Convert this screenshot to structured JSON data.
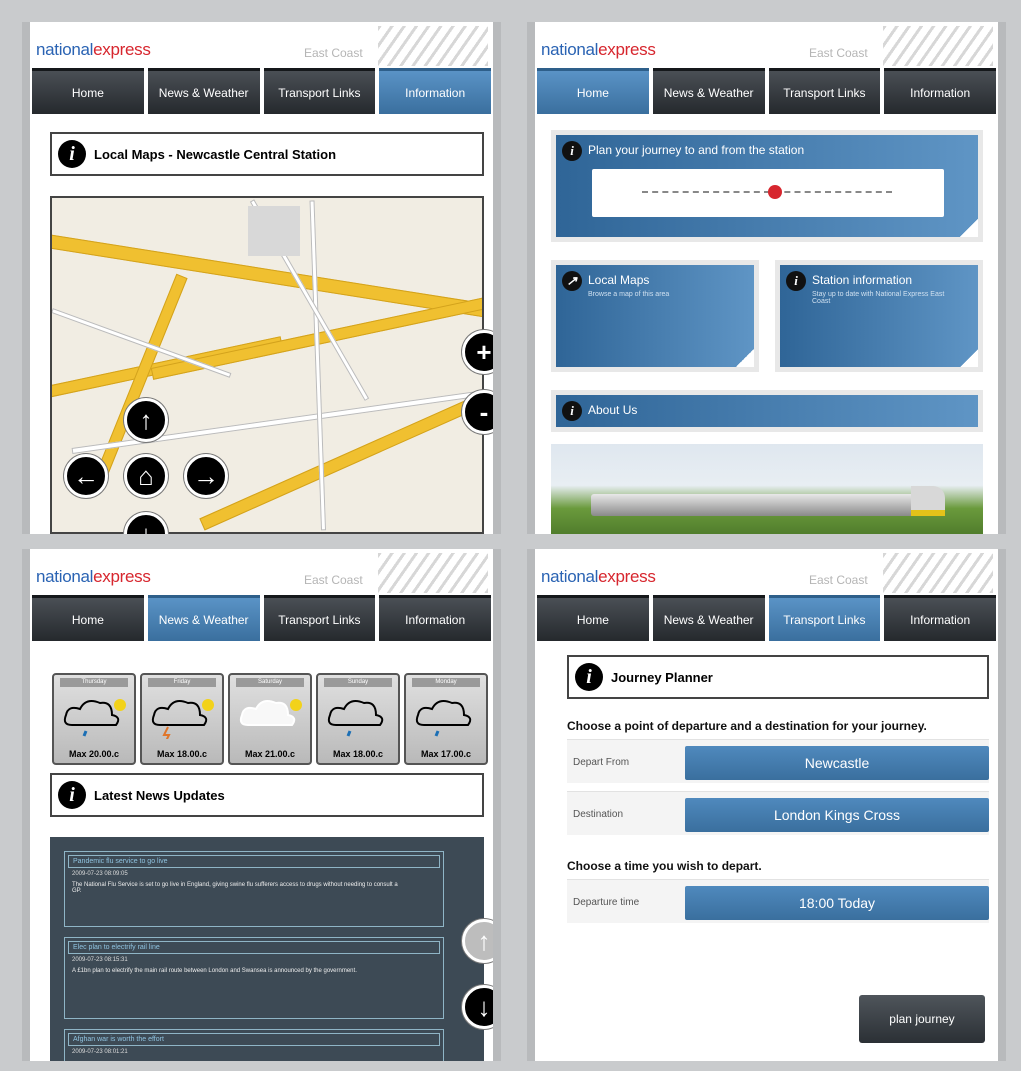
{
  "brand": {
    "logo_part1": "national",
    "logo_part2": "express",
    "region": "East Coast"
  },
  "nav": [
    "Home",
    "News & Weather",
    "Transport Links",
    "Information"
  ],
  "screens": {
    "maps": {
      "title": "Local Maps - Newcastle Central Station",
      "zoom_in": "+",
      "zoom_out": "-"
    },
    "home": {
      "plan_text": "Plan your journey to and from the station",
      "local_maps": {
        "title": "Local Maps",
        "subtitle": "Browse a map of this area"
      },
      "station_info": {
        "title": "Station information",
        "subtitle": "Stay up to date with National Express East Coast"
      },
      "about": "About Us"
    },
    "news": {
      "weather": [
        {
          "day": "Thursday",
          "max": "Max 20.00.c"
        },
        {
          "day": "Friday",
          "max": "Max 18.00.c"
        },
        {
          "day": "Saturday",
          "max": "Max 21.00.c"
        },
        {
          "day": "Sunday",
          "max": "Max 18.00.c"
        },
        {
          "day": "Monday",
          "max": "Max 17.00.c"
        }
      ],
      "title": "Latest News Updates",
      "items": [
        {
          "headline": "Pandemic flu service to go live",
          "date": "2009-07-23 08:09:05",
          "text": "The National Flu Service is set to go live in England, giving swine flu sufferers access to drugs without needing to consult a GP."
        },
        {
          "headline": "Elec plan to electrify rail line",
          "date": "2009-07-23 08:15:31",
          "text": "A £1bn plan to electrify the main rail route between London and Swansea is announced by the government."
        },
        {
          "headline": "Afghan war is worth the effort",
          "date": "2009-07-23 08:01:21",
          "text": ""
        }
      ]
    },
    "journey": {
      "title": "Journey Planner",
      "prompt": "Choose a point of departure and a destination for your journey.",
      "depart_label": "Depart From",
      "depart_value": "Newcastle",
      "dest_label": "Destination",
      "dest_value": "London Kings Cross",
      "time_prompt": "Choose a time you wish to depart.",
      "time_label": "Departure time",
      "time_value": "18:00 Today",
      "button": "plan journey"
    }
  }
}
